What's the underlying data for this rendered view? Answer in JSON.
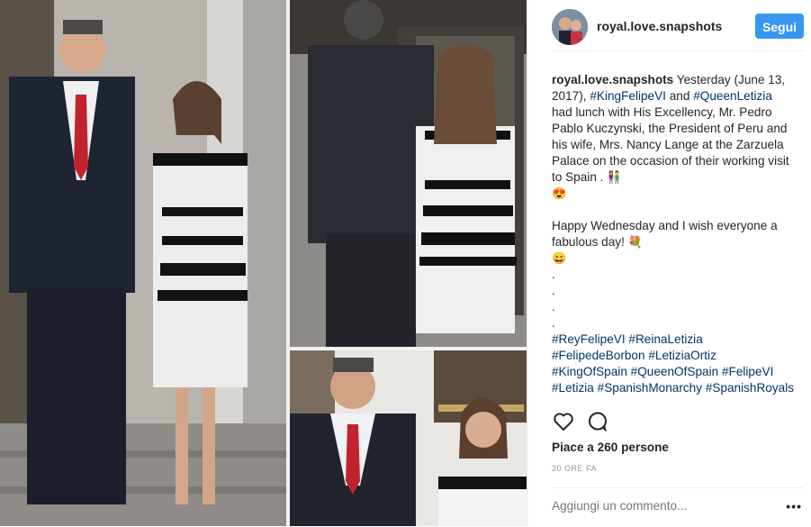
{
  "post": {
    "username": "royal.love.snapshots",
    "follow_label": "Segui",
    "caption": {
      "author": "royal.love.snapshots",
      "text1": "Yesterday (June 13, 2017),",
      "tag1": "#KingFelipeVI",
      "and": "and",
      "tag2": "#QueenLetizia",
      "text2": "had lunch with His Excellency, Mr. Pedro Pablo Kuczynski, the President of Peru and his wife, Mrs. Nancy Lange at the Zarzuela Palace on the occasion of their working visit to Spain .",
      "emoji1": "👫",
      "emoji2": "😍",
      "para2": "Happy Wednesday and I wish everyone a fabulous day!",
      "emoji3": "💐",
      "emoji4": "😄",
      "dot": ".",
      "hashtags": [
        [
          "#ReyFelipeVI",
          "#ReinaLetizia"
        ],
        [
          "#FelipedeBorbon",
          "#LetiziaOrtiz"
        ],
        [
          "#KingOfSpain",
          "#QueenOfSpain",
          "#FelipeVI"
        ],
        [
          "#Letizia",
          "#SpanishMonarchy",
          "#SpanishRoyals"
        ]
      ]
    },
    "likes": "Piace a 260 persone",
    "time": "20 ORE FA",
    "comment_placeholder": "Aggiungi un commento...",
    "more_label": "•••"
  },
  "icons": {
    "like": "heart-icon",
    "comment": "comment-icon",
    "options": "more-options-icon"
  },
  "colors": {
    "follow_bg": "#3897f0",
    "hashtag": "#003569",
    "muted": "#999999"
  }
}
